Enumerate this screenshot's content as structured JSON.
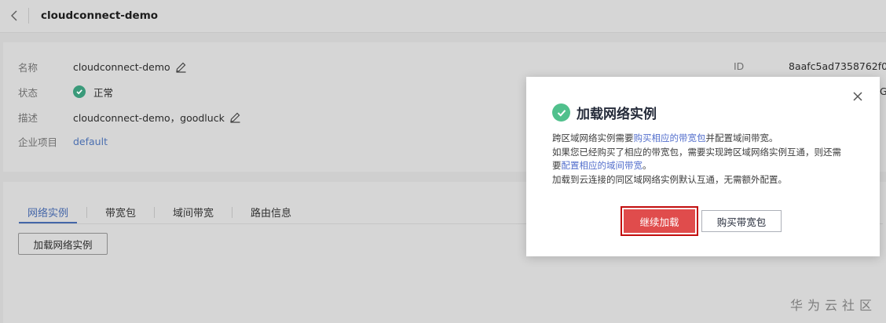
{
  "header": {
    "title": "cloudconnect-demo",
    "back_icon": "chevron-left-icon"
  },
  "info": {
    "name_label": "名称",
    "name_value": "cloudconnect-demo",
    "status_label": "状态",
    "status_value": "正常",
    "desc_label": "描述",
    "desc_value": "cloudconnect-demo，goodluck",
    "project_label": "企业项目",
    "project_value": "default",
    "id_label": "ID",
    "id_value": "8aafc5ad7358762f0173",
    "extra_truncated": "G"
  },
  "tabs": [
    {
      "label": "网络实例",
      "active": true
    },
    {
      "label": "带宽包",
      "active": false
    },
    {
      "label": "域间带宽",
      "active": false
    },
    {
      "label": "路由信息",
      "active": false
    }
  ],
  "actions": {
    "load_instance_label": "加载网络实例"
  },
  "modal": {
    "title": "加载网络实例",
    "line1_pre": "跨区域网络实例需要",
    "line1_link": "购买相应的带宽包",
    "line1_post": "并配置域间带宽。",
    "line2": "如果您已经购买了相应的带宽包，需要实现跨区域网络实例互通，则还需",
    "line3_pre": "要",
    "line3_link": "配置相应的域间带宽",
    "line3_post": "。",
    "line4": "加载到云连接的同区域网络实例默认互通，无需额外配置。",
    "continue_label": "继续加载",
    "buy_label": "购买带宽包"
  },
  "watermark": "华为云社区",
  "colors": {
    "accent": "#4466a8",
    "success": "#50c08c",
    "danger": "#e04c4c"
  }
}
